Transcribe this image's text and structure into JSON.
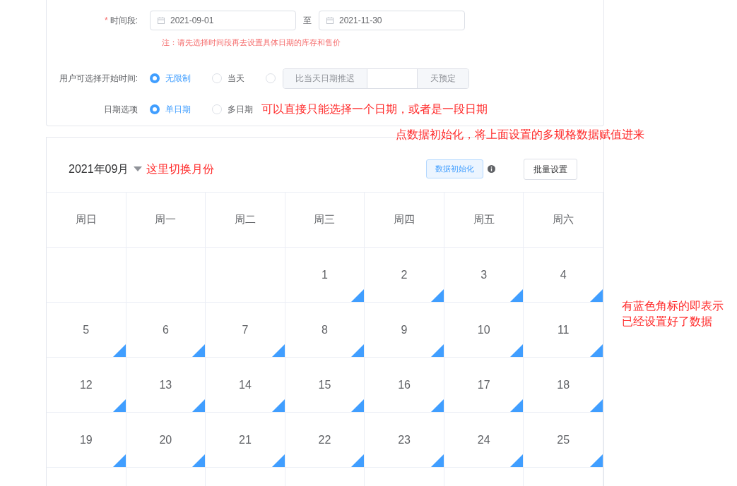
{
  "form": {
    "date_range": {
      "label": "时间段:",
      "required_mark": "*",
      "start": "2021-09-01",
      "separator": "至",
      "end": "2021-11-30",
      "note": "注：请先选择时间段再去设置具体日期的库存和售价"
    },
    "start_time": {
      "label": "用户可选择开始时间:",
      "options": [
        {
          "kind": "plain",
          "label": "无限制",
          "selected": true
        },
        {
          "kind": "plain",
          "label": "当天",
          "selected": false
        },
        {
          "kind": "delay",
          "prefix": "比当天日期推迟",
          "suffix": "天预定",
          "selected": false
        }
      ]
    },
    "date_option": {
      "label": "日期选项",
      "options": [
        {
          "kind": "plain",
          "label": "单日期",
          "selected": true
        },
        {
          "kind": "plain",
          "label": "多日期",
          "selected": false
        }
      ],
      "annotation": "可以直接只能选择一个日期，或者是一段日期"
    }
  },
  "calendar": {
    "month": "2021年09月",
    "month_annotation": "这里切换月份",
    "init_button": "数据初始化",
    "init_annotation": "点数据初始化，将上面设置的多规格数据赋值进来",
    "batch_button": "批量设置",
    "weekdays": [
      "周日",
      "周一",
      "周二",
      "周三",
      "周四",
      "周五",
      "周六"
    ],
    "weeks": [
      [
        {
          "marked": false
        },
        {
          "marked": false
        },
        {
          "marked": false
        },
        {
          "day": "1",
          "marked": true
        },
        {
          "day": "2",
          "marked": true
        },
        {
          "day": "3",
          "marked": true
        },
        {
          "day": "4",
          "marked": true
        }
      ],
      [
        {
          "day": "5",
          "marked": true
        },
        {
          "day": "6",
          "marked": true
        },
        {
          "day": "7",
          "marked": true
        },
        {
          "day": "8",
          "marked": true
        },
        {
          "day": "9",
          "marked": true
        },
        {
          "day": "10",
          "marked": true
        },
        {
          "day": "11",
          "marked": true
        }
      ],
      [
        {
          "day": "12",
          "marked": true
        },
        {
          "day": "13",
          "marked": true
        },
        {
          "day": "14",
          "marked": true
        },
        {
          "day": "15",
          "marked": true
        },
        {
          "day": "16",
          "marked": true
        },
        {
          "day": "17",
          "marked": true
        },
        {
          "day": "18",
          "marked": true
        }
      ],
      [
        {
          "day": "19",
          "marked": true
        },
        {
          "day": "20",
          "marked": true
        },
        {
          "day": "21",
          "marked": true
        },
        {
          "day": "22",
          "marked": true
        },
        {
          "day": "23",
          "marked": true
        },
        {
          "day": "24",
          "marked": true
        },
        {
          "day": "25",
          "marked": true
        }
      ]
    ],
    "corner_annotation": [
      "有蓝色角标的即表示",
      "已经设置好了数据"
    ]
  }
}
